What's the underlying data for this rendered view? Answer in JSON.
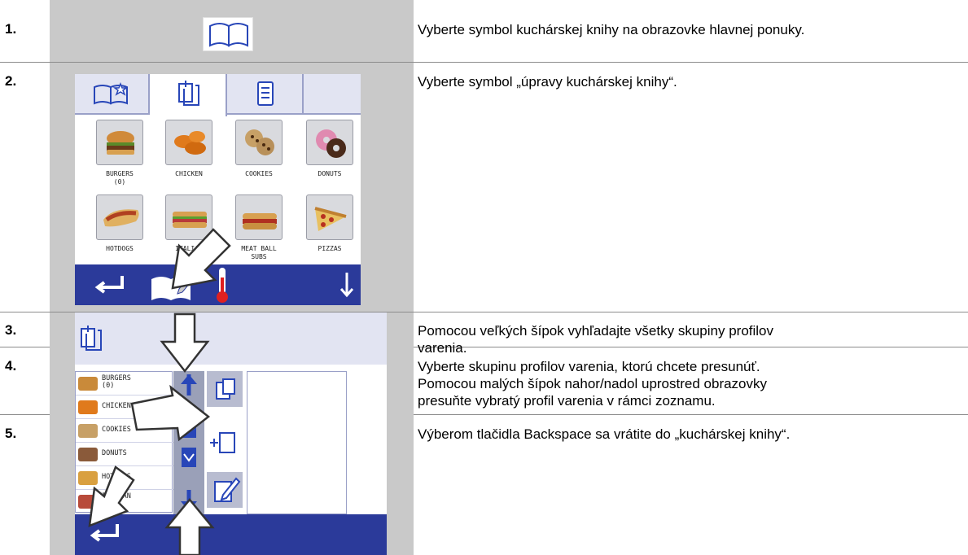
{
  "steps": [
    {
      "number": "1.",
      "text": "Vyberte symbol kuchárskej knihy na obrazovke hlavnej ponuky."
    },
    {
      "number": "2.",
      "text": "Vyberte symbol „úpravy kuchárskej knihy“."
    },
    {
      "number": "3.",
      "text_lines": [
        "Pomocou veľkých šípok vyhľadajte všetky skupiny profilov",
        "varenia."
      ]
    },
    {
      "number": "4.",
      "text_lines": [
        "Vyberte skupinu profilov varenia, ktorú chcete presunúť.",
        "Pomocou malých šípok nahor/nadol uprostred obrazovky",
        "presuňte vybratý profil varenia v rámci zoznamu."
      ]
    },
    {
      "number": "5.",
      "text": "Výberom tlačidla Backspace sa vrátite do „kuchárskej knihy“."
    }
  ],
  "cookbook_screen": {
    "tiles": [
      {
        "label_lines": [
          "BURGERS",
          "(0)"
        ],
        "icon": "burger-icon"
      },
      {
        "label_lines": [
          "CHICKEN"
        ],
        "icon": "chicken-icon"
      },
      {
        "label_lines": [
          "COOKIES"
        ],
        "icon": "cookies-icon"
      },
      {
        "label_lines": [
          "DONUTS"
        ],
        "icon": "donuts-icon"
      },
      {
        "label_lines": [
          "HOTDOGS"
        ],
        "icon": "hotdog-icon"
      },
      {
        "label_lines": [
          "ITALIAN",
          "SUBS"
        ],
        "icon": "italian-sub-icon"
      },
      {
        "label_lines": [
          "MEAT BALL",
          "SUBS"
        ],
        "icon": "meatball-sub-icon"
      },
      {
        "label_lines": [
          "PIZZAS"
        ],
        "icon": "pizza-icon"
      }
    ]
  },
  "edit_screen": {
    "list": [
      {
        "label_lines": [
          "BURGERS",
          "(0)"
        ],
        "color": "#c98a3a"
      },
      {
        "label_lines": [
          "CHICKEN"
        ],
        "color": "#e07a1c"
      },
      {
        "label_lines": [
          "COOKIES"
        ],
        "color": "#c7a066"
      },
      {
        "label_lines": [
          "DONUTS"
        ],
        "color": "#8a5a3a"
      },
      {
        "label_lines": [
          "HOTDOGS"
        ],
        "color": "#d9a040"
      },
      {
        "label_lines": [
          "ITALIAN",
          "SUBS"
        ],
        "color": "#b84a3a"
      }
    ]
  },
  "colors": {
    "screen_bar": "#2b3a9a",
    "tab_bar": "#e2e4f2",
    "frame": "#c9c9c9",
    "arrow_blue": "#2846b8"
  }
}
